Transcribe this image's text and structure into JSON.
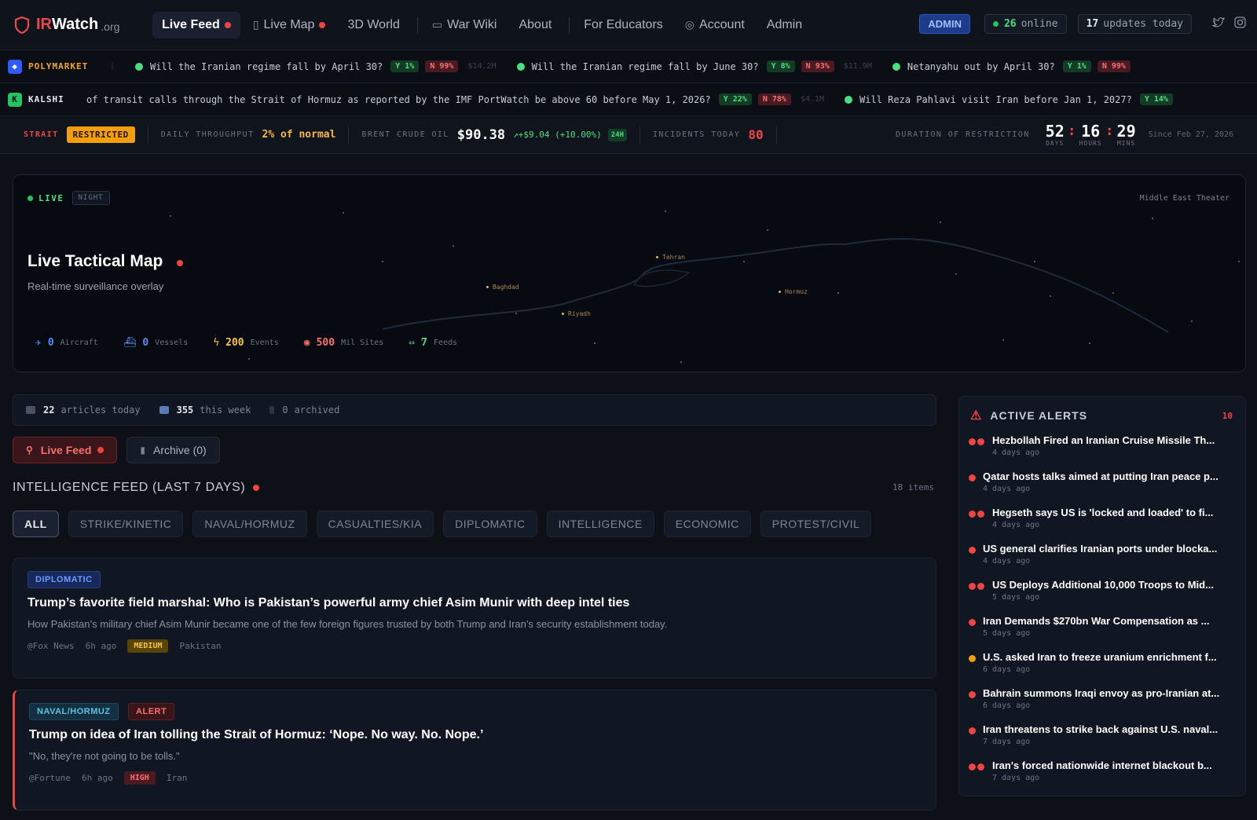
{
  "brand": {
    "name1": "IR",
    "name2": "Watch",
    "suffix": ".org"
  },
  "nav": {
    "links": [
      {
        "label": "Live Feed",
        "icon": "",
        "active": true
      },
      {
        "label": "Live Map",
        "icon": "map-icon"
      },
      {
        "label": "3D World"
      },
      {
        "label": "War Wiki",
        "icon": "book-icon"
      },
      {
        "label": "About"
      },
      {
        "label": "For Educators"
      },
      {
        "label": "Account",
        "icon": "user-icon"
      },
      {
        "label": "Admin"
      }
    ],
    "admin_badge": "ADMIN",
    "online_count": "26",
    "online_label": "online",
    "updates_count": "17",
    "updates_label": "updates today"
  },
  "polymarket": {
    "label": "POLYMARKET",
    "items": [
      {
        "q": "Will the Iranian regime fall by April 30?",
        "yes": "Y 1%",
        "no": "N 99%",
        "vol": "$14.2M"
      },
      {
        "q": "Will the Iranian regime fall by June 30?",
        "yes": "Y 8%",
        "no": "N 93%",
        "vol": "$11.9M"
      },
      {
        "q": "Netanyahu out by April 30?",
        "yes": "Y 1%",
        "no": "N 99%",
        "vol": ""
      }
    ]
  },
  "kalshi": {
    "label": "KALSHI",
    "items": [
      {
        "q": "of transit calls through the Strait of Hormuz as reported by the IMF PortWatch be above 60 before May 1, 2026?",
        "yes": "Y 22%",
        "no": "N 78%",
        "vol": "$4.1M"
      },
      {
        "q": "Will Reza Pahlavi visit Iran before Jan 1, 2027?",
        "yes": "Y 14%",
        "no": "",
        "vol": ""
      }
    ]
  },
  "status": {
    "strait_label": "STRAIT",
    "strait_value": "RESTRICTED",
    "throughput_label": "DAILY THROUGHPUT",
    "throughput_value": "2% of normal",
    "brent_label": "BRENT CRUDE OIL",
    "brent_price": "$90.38",
    "brent_change": "↗+$9.04 (+10.00%)",
    "brent_window": "24H",
    "incidents_label": "INCIDENTS TODAY",
    "incidents_value": "80",
    "duration_label": "DURATION OF RESTRICTION",
    "days": "52",
    "days_label": "DAYS",
    "hours": "16",
    "hours_label": "HOURS",
    "mins": "29",
    "mins_label": "MINS",
    "since": "Since Feb 27, 2026"
  },
  "map": {
    "live": "LIVE",
    "mode": "NIGHT",
    "theater": "Middle East Theater",
    "title": "Live Tactical Map",
    "subtitle": "Real-time surveillance overlay",
    "cities": [
      "Tehran",
      "Baghdad",
      "Riyadh",
      "Hormuz"
    ],
    "stats": [
      {
        "icon": "aircraft-icon",
        "value": "0",
        "label": "Aircraft",
        "color": "#4f8cff"
      },
      {
        "icon": "vessel-icon",
        "value": "0",
        "label": "Vessels",
        "color": "#5b8def"
      },
      {
        "icon": "lightning-icon",
        "value": "200",
        "label": "Events",
        "color": "#f5c542"
      },
      {
        "icon": "pin-icon",
        "value": "500",
        "label": "Mil Sites",
        "color": "#f87171"
      },
      {
        "icon": "signal-icon",
        "value": "7",
        "label": "Feeds",
        "color": "#4ade80"
      }
    ]
  },
  "articles": {
    "today": "22",
    "today_label": "articles today",
    "week": "355",
    "week_label": "this week",
    "archived": "0",
    "archived_label": "archived"
  },
  "tabs": {
    "live": "Live Feed",
    "archive": "Archive (0)"
  },
  "feed": {
    "title": "INTELLIGENCE FEED (LAST 7 DAYS)",
    "count": "18 items",
    "filters": [
      "ALL",
      "STRIKE/KINETIC",
      "NAVAL/HORMUZ",
      "CASUALTIES/KIA",
      "DIPLOMATIC",
      "INTELLIGENCE",
      "ECONOMIC",
      "PROTEST/CIVIL"
    ],
    "cards": [
      {
        "category": "DIPLOMATIC",
        "title": "Trump’s favorite field marshal: Who is Pakistan’s powerful army chief Asim Munir with deep intel ties",
        "desc": "How Pakistan’s military chief Asim Munir became one of the few foreign figures trusted by both Trump and Iran’s security establishment today.",
        "source": "@Fox News",
        "time": "6h ago",
        "severity": "MEDIUM",
        "region": "Pakistan"
      },
      {
        "category": "NAVAL/HORMUZ",
        "flag": "ALERT",
        "title": "Trump on idea of Iran tolling the Strait of Hormuz: ‘Nope. No way. No. Nope.’",
        "desc": "\"No, they're not going to be tolls.\"",
        "source": "@Fortune",
        "time": "6h ago",
        "severity": "HIGH",
        "region": "Iran"
      }
    ]
  },
  "alerts": {
    "title": "ACTIVE ALERTS",
    "count": "10",
    "items": [
      {
        "title": "Hezbollah Fired an Iranian Cruise Missile Th...",
        "time": "4 days ago",
        "dots": [
          "#ef4444",
          "#ef4444"
        ]
      },
      {
        "title": "Qatar hosts talks aimed at putting Iran peace p...",
        "time": "4 days ago",
        "dots": [
          "#ef4444"
        ]
      },
      {
        "title": "Hegseth says US is 'locked and loaded' to fi...",
        "time": "4 days ago",
        "dots": [
          "#ef4444",
          "#ef4444"
        ]
      },
      {
        "title": "US general clarifies Iranian ports under blocka...",
        "time": "4 days ago",
        "dots": [
          "#ef4444"
        ]
      },
      {
        "title": "US Deploys Additional 10,000 Troops to Mid...",
        "time": "5 days ago",
        "dots": [
          "#ef4444",
          "#ef4444"
        ]
      },
      {
        "title": "Iran Demands $270bn War Compensation as ...",
        "time": "5 days ago",
        "dots": [
          "#ef4444"
        ]
      },
      {
        "title": "U.S. asked Iran to freeze uranium enrichment f...",
        "time": "6 days ago",
        "dots": [
          "#f59e0b"
        ]
      },
      {
        "title": "Bahrain summons Iraqi envoy as pro-Iranian at...",
        "time": "6 days ago",
        "dots": [
          "#ef4444"
        ]
      },
      {
        "title": "Iran threatens to strike back against U.S. naval...",
        "time": "7 days ago",
        "dots": [
          "#ef4444"
        ]
      },
      {
        "title": "Iran's forced nationwide internet blackout b...",
        "time": "7 days ago",
        "dots": [
          "#ef4444",
          "#ef4444"
        ]
      }
    ]
  },
  "colors": {
    "accent_red": "#ef4444",
    "accent_green": "#4ade80",
    "accent_amber": "#f59e0b",
    "background": "#0d1117"
  }
}
